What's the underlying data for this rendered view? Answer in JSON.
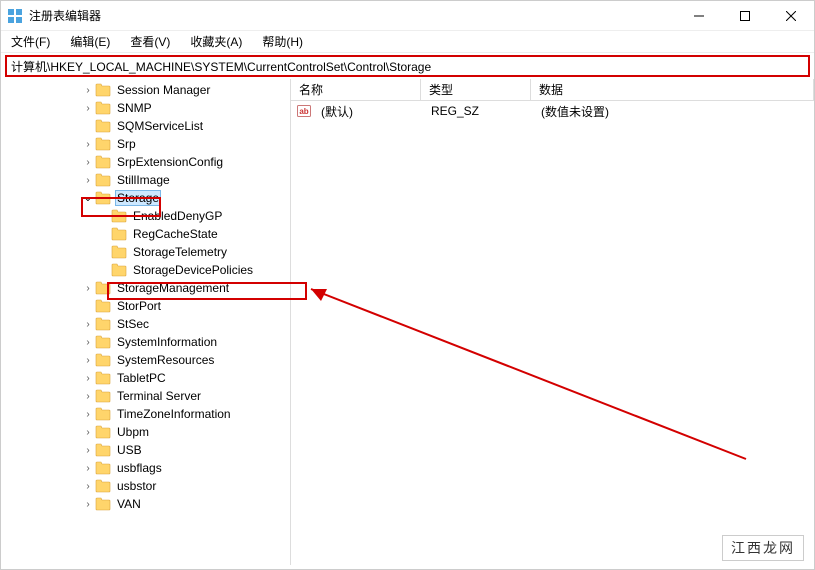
{
  "title": "注册表编辑器",
  "menu": [
    "文件(F)",
    "编辑(E)",
    "查看(V)",
    "收藏夹(A)",
    "帮助(H)"
  ],
  "address": "计算机\\HKEY_LOCAL_MACHINE\\SYSTEM\\CurrentControlSet\\Control\\Storage",
  "columns": [
    "名称",
    "类型",
    "数据"
  ],
  "values": [
    {
      "name": "(默认)",
      "type": "REG_SZ",
      "data": "(数值未设置)"
    }
  ],
  "tree": [
    {
      "indent": 5,
      "expand": "closed",
      "label": "Session Manager"
    },
    {
      "indent": 5,
      "expand": "closed",
      "label": "SNMP"
    },
    {
      "indent": 5,
      "expand": "none",
      "label": "SQMServiceList"
    },
    {
      "indent": 5,
      "expand": "closed",
      "label": "Srp"
    },
    {
      "indent": 5,
      "expand": "closed",
      "label": "SrpExtensionConfig"
    },
    {
      "indent": 5,
      "expand": "closed",
      "label": "StillImage"
    },
    {
      "indent": 5,
      "expand": "open",
      "label": "Storage",
      "selected": true
    },
    {
      "indent": 6,
      "expand": "none",
      "label": "EnabledDenyGP"
    },
    {
      "indent": 6,
      "expand": "none",
      "label": "RegCacheState"
    },
    {
      "indent": 6,
      "expand": "none",
      "label": "StorageTelemetry"
    },
    {
      "indent": 6,
      "expand": "none",
      "label": "StorageDevicePolicies"
    },
    {
      "indent": 5,
      "expand": "closed",
      "label": "StorageManagement"
    },
    {
      "indent": 5,
      "expand": "none",
      "label": "StorPort"
    },
    {
      "indent": 5,
      "expand": "closed",
      "label": "StSec"
    },
    {
      "indent": 5,
      "expand": "closed",
      "label": "SystemInformation"
    },
    {
      "indent": 5,
      "expand": "closed",
      "label": "SystemResources"
    },
    {
      "indent": 5,
      "expand": "closed",
      "label": "TabletPC"
    },
    {
      "indent": 5,
      "expand": "closed",
      "label": "Terminal Server"
    },
    {
      "indent": 5,
      "expand": "closed",
      "label": "TimeZoneInformation"
    },
    {
      "indent": 5,
      "expand": "closed",
      "label": "Ubpm"
    },
    {
      "indent": 5,
      "expand": "closed",
      "label": "USB"
    },
    {
      "indent": 5,
      "expand": "closed",
      "label": "usbflags"
    },
    {
      "indent": 5,
      "expand": "closed",
      "label": "usbstor"
    },
    {
      "indent": 5,
      "expand": "closed",
      "label": "VAN"
    }
  ],
  "watermark": "江西龙网"
}
